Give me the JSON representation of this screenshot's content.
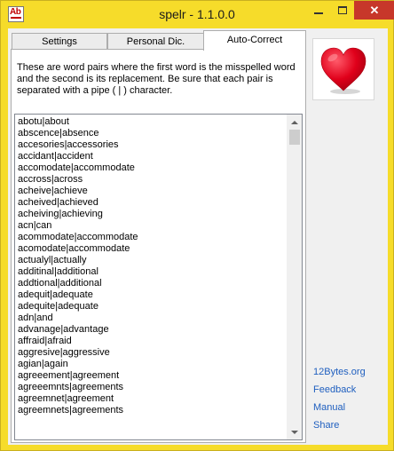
{
  "window": {
    "title": "spelr - 1.1.0.0",
    "app_icon_text": "Ab",
    "close_symbol": "✕",
    "accent_color": "#f6dc2a",
    "close_color": "#c7372a"
  },
  "tabs": [
    {
      "label": "Settings",
      "selected": false
    },
    {
      "label": "Personal Dic.",
      "selected": false
    },
    {
      "label": "Auto-Correct",
      "selected": true
    }
  ],
  "autocorrect": {
    "description": "These are word pairs where the first word is the misspelled word and the second is its replacement. Be sure that each pair is separated with a pipe ( | ) character.",
    "entries": [
      "abotu|about",
      "abscence|absence",
      "accesories|accessories",
      "accidant|accident",
      "accomodate|accommodate",
      "accross|across",
      "acheive|achieve",
      "acheived|achieved",
      "acheiving|achieving",
      "acn|can",
      "acommodate|accommodate",
      "acomodate|accommodate",
      "actualyl|actually",
      "additinal|additional",
      "addtional|additional",
      "adequit|adequate",
      "adequite|adequate",
      "adn|and",
      "advanage|advantage",
      "affraid|afraid",
      "aggresive|aggressive",
      "agian|again",
      "agreeement|agreement",
      "agreeemnts|agreements",
      "agreemnet|agreement",
      "agreemnets|agreements"
    ]
  },
  "logo": {
    "icon": "heart-icon",
    "color": "#e0001a"
  },
  "links": [
    {
      "label": "12Bytes.org"
    },
    {
      "label": "Feedback"
    },
    {
      "label": "Manual"
    },
    {
      "label": "Share"
    }
  ]
}
